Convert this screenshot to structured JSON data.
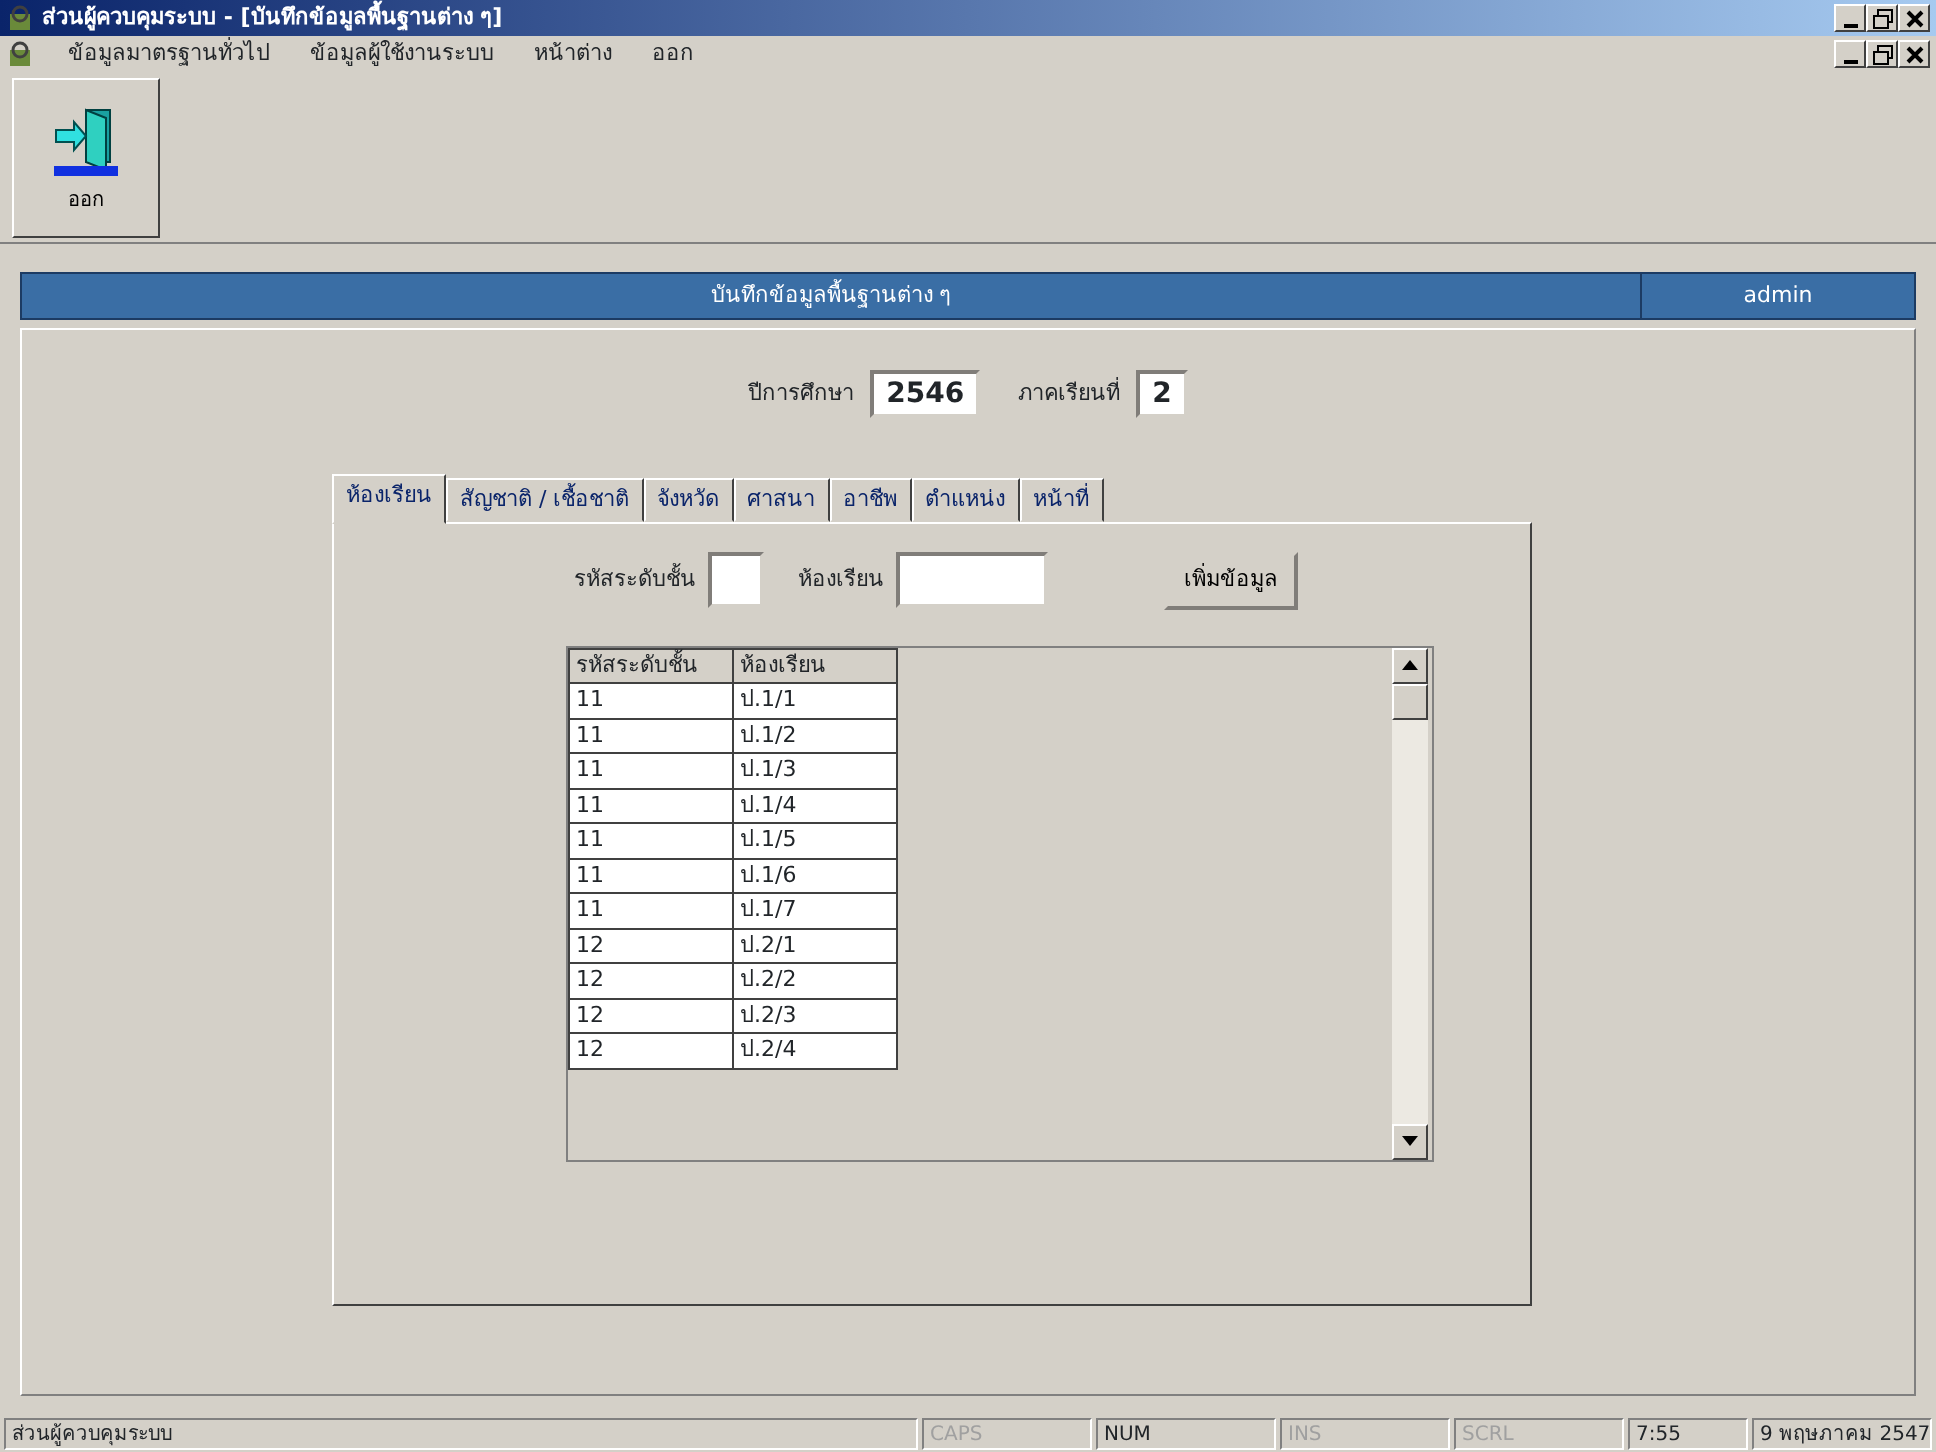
{
  "window": {
    "title": "ส่วนผู้ควบคุมระบบ - [บันทึกข้อมูลพื้นฐานต่าง ๆ]"
  },
  "menu": [
    "ข้อมูลมาตรฐานทั่วไป",
    "ข้อมูลผู้ใช้งานระบบ",
    "หน้าต่าง",
    "ออก"
  ],
  "toolbar": [
    {
      "label": "ออก"
    }
  ],
  "header": {
    "title": "บันทึกข้อมูลพื้นฐานต่าง ๆ",
    "user": "admin"
  },
  "term": {
    "year_label": "ปีการศึกษา",
    "year": "2546",
    "semester_label": "ภาคเรียนที่",
    "semester": "2"
  },
  "tabs": [
    {
      "label": "ห้องเรียน",
      "selected": true
    },
    {
      "label": "สัญชาติ / เชื้อชาติ",
      "selected": false
    },
    {
      "label": "จังหวัด",
      "selected": false
    },
    {
      "label": "ศาสนา",
      "selected": false
    },
    {
      "label": "อาชีพ",
      "selected": false
    },
    {
      "label": "ตำแหน่ง",
      "selected": false
    },
    {
      "label": "หน้าที่",
      "selected": false
    }
  ],
  "form": {
    "level_label": "รหัสระดับชั้น",
    "room_label": "ห้องเรียน",
    "add_button": "เพิ่มข้อมูล"
  },
  "table": {
    "columns": [
      "รหัสระดับชั้น",
      "ห้องเรียน"
    ],
    "rows": [
      [
        "11",
        "ป.1/1"
      ],
      [
        "11",
        "ป.1/2"
      ],
      [
        "11",
        "ป.1/3"
      ],
      [
        "11",
        "ป.1/4"
      ],
      [
        "11",
        "ป.1/5"
      ],
      [
        "11",
        "ป.1/6"
      ],
      [
        "11",
        "ป.1/7"
      ],
      [
        "12",
        "ป.2/1"
      ],
      [
        "12",
        "ป.2/2"
      ],
      [
        "12",
        "ป.2/3"
      ],
      [
        "12",
        "ป.2/4"
      ]
    ]
  },
  "status_bar": [
    {
      "text": "ส่วนผู้ควบคุมระบบ",
      "enabled": true
    },
    {
      "text": "CAPS",
      "enabled": false
    },
    {
      "text": "NUM",
      "enabled": true
    },
    {
      "text": "INS",
      "enabled": false
    },
    {
      "text": "SCRL",
      "enabled": false
    },
    {
      "text": "7:55",
      "enabled": true
    },
    {
      "text": "9 พฤษภาคม 2547",
      "enabled": true
    }
  ]
}
